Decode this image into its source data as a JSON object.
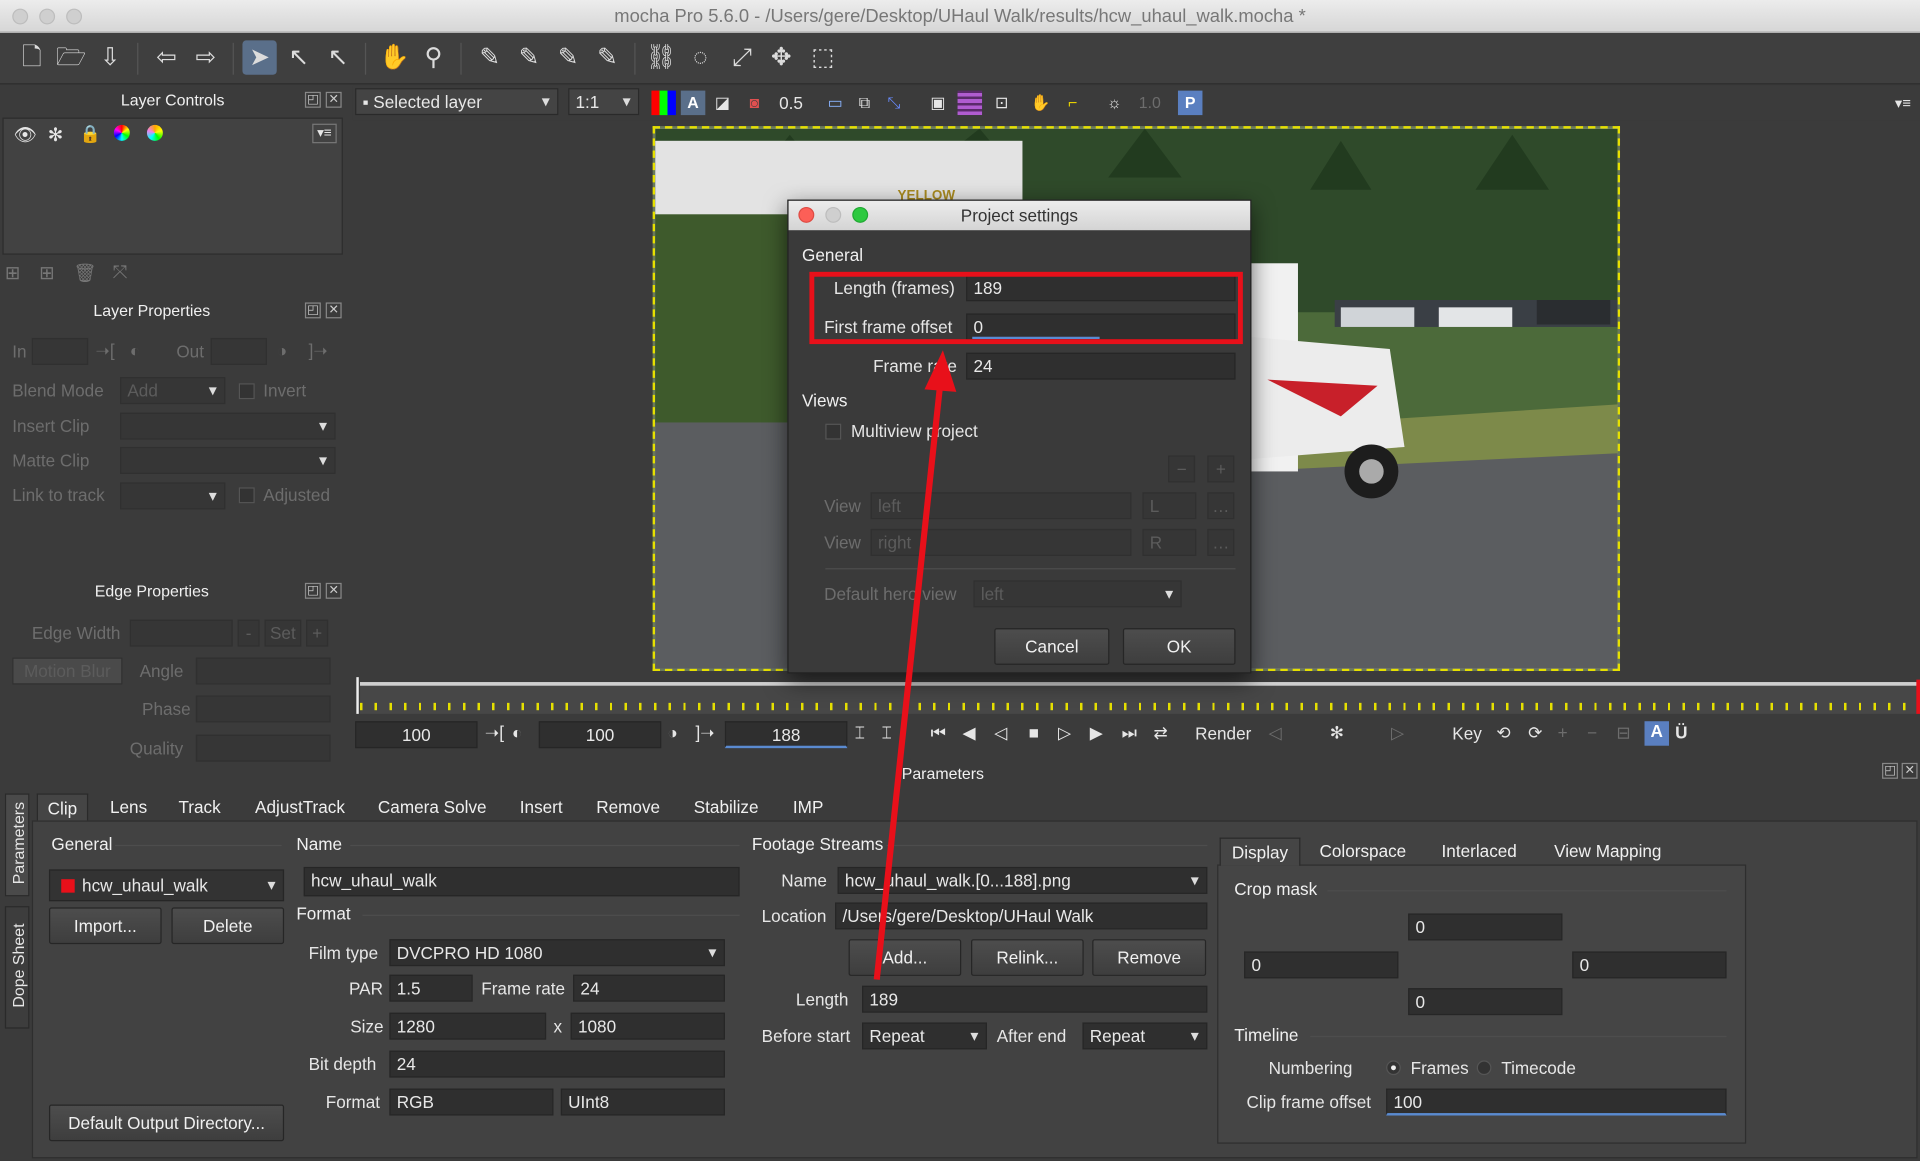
{
  "window": {
    "title": "mocha Pro 5.6.0 - /Users/gere/Desktop/UHaul Walk/results/hcw_uhaul_walk.mocha *"
  },
  "layer_controls": {
    "title": "Layer Controls"
  },
  "layer_properties": {
    "title": "Layer Properties",
    "in_label": "In",
    "out_label": "Out",
    "blend_mode_label": "Blend Mode",
    "blend_mode_value": "Add",
    "invert_label": "Invert",
    "insert_clip_label": "Insert Clip",
    "matte_clip_label": "Matte Clip",
    "link_to_track_label": "Link to track",
    "adjusted_label": "Adjusted"
  },
  "edge_properties": {
    "title": "Edge Properties",
    "edge_width_label": "Edge Width",
    "set_label": "Set",
    "motion_blur_label": "Motion Blur",
    "angle_label": "Angle",
    "phase_label": "Phase",
    "quality_label": "Quality"
  },
  "viewer_bar": {
    "layer_select": "Selected layer",
    "zoom": "1:1",
    "opacity": "0.5",
    "gamma": "1.0",
    "p_label": "P"
  },
  "truck_text": "YELLOW",
  "dialog": {
    "title": "Project settings",
    "general_label": "General",
    "length_label": "Length (frames)",
    "length_value": "189",
    "first_frame_label": "First frame offset",
    "first_frame_value": "0",
    "frame_rate_label": "Frame rate",
    "frame_rate_value": "24",
    "views_label": "Views",
    "multiview_label": "Multiview project",
    "view_label": "View",
    "view1_name": "left",
    "view1_short": "L",
    "view2_name": "right",
    "view2_short": "R",
    "default_hero_label": "Default hero view",
    "default_hero_value": "left",
    "cancel": "Cancel",
    "ok": "OK"
  },
  "transport": {
    "in_value": "100",
    "mid_value": "100",
    "current_frame": "188",
    "render_label": "Render",
    "key_label": "Key"
  },
  "params": {
    "title": "Parameters",
    "side_tabs": [
      "Parameters",
      "Dope Sheet"
    ],
    "tabs": [
      "Clip",
      "Lens",
      "Track",
      "AdjustTrack",
      "Camera Solve",
      "Insert",
      "Remove",
      "Stabilize",
      "IMP"
    ],
    "general_label": "General",
    "clip_name": "hcw_uhaul_walk",
    "import": "Import...",
    "delete": "Delete",
    "default_output": "Default Output Directory...",
    "name_label": "Name",
    "name_value": "hcw_uhaul_walk",
    "format_label": "Format",
    "film_type_label": "Film type",
    "film_type_value": "DVCPRO HD 1080",
    "par_label": "PAR",
    "par_value": "1.5",
    "frame_rate_label": "Frame rate",
    "frame_rate_value": "24",
    "size_label": "Size",
    "size_w": "1280",
    "size_x": "x",
    "size_h": "1080",
    "bit_depth_label": "Bit depth",
    "bit_depth_value": "24",
    "format_row_label": "Format",
    "format_value": "RGB",
    "format_type": "UInt8",
    "footage_label": "Footage Streams",
    "fs_name_label": "Name",
    "fs_name_value": "hcw_uhaul_walk.[0...188].png",
    "location_label": "Location",
    "location_value": "/Users/gere/Desktop/UHaul Walk",
    "add": "Add...",
    "relink": "Relink...",
    "remove": "Remove",
    "length_label": "Length",
    "length_value": "189",
    "before_start_label": "Before start",
    "before_start_value": "Repeat",
    "after_end_label": "After end",
    "after_end_value": "Repeat",
    "right_tabs": [
      "Display",
      "Colorspace",
      "Interlaced",
      "View Mapping"
    ],
    "crop_mask_label": "Crop mask",
    "crop_top": "0",
    "crop_left": "0",
    "crop_right": "0",
    "crop_bottom": "0",
    "timeline_label": "Timeline",
    "numbering_label": "Numbering",
    "frames_label": "Frames",
    "timecode_label": "Timecode",
    "clip_offset_label": "Clip frame offset",
    "clip_offset_value": "100"
  },
  "colors": {
    "highlight": "#e8101a",
    "viewer_border": "#e6e000",
    "accent": "#5a6f8a"
  }
}
